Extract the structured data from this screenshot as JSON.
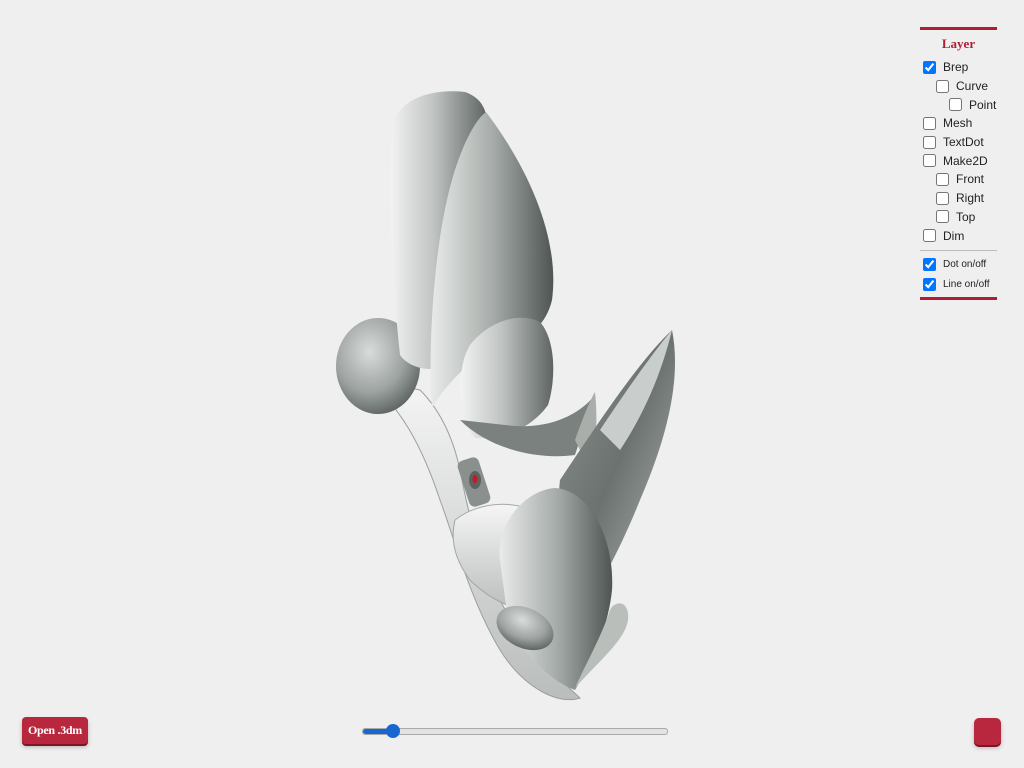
{
  "layer_panel": {
    "title": "Layer",
    "layers": [
      {
        "label": "Brep",
        "checked": true
      },
      {
        "label": "Curve",
        "checked": false
      },
      {
        "label": "Point",
        "checked": false
      },
      {
        "label": "Mesh",
        "checked": false
      },
      {
        "label": "TextDot",
        "checked": false
      },
      {
        "label": "Make2D",
        "checked": false
      },
      {
        "label": "Front",
        "checked": false
      },
      {
        "label": "Right",
        "checked": false
      },
      {
        "label": "Top",
        "checked": false
      },
      {
        "label": "Dim",
        "checked": false
      }
    ],
    "toggles": [
      {
        "label": "Dot on/off",
        "checked": true
      },
      {
        "label": "Line on/off",
        "checked": true
      }
    ]
  },
  "controls": {
    "open_button_label": "Open .3dm",
    "slider_value": 0.1
  },
  "colors": {
    "accent": "#b8273d",
    "slider": "#1766d1",
    "background": "#efefef"
  }
}
